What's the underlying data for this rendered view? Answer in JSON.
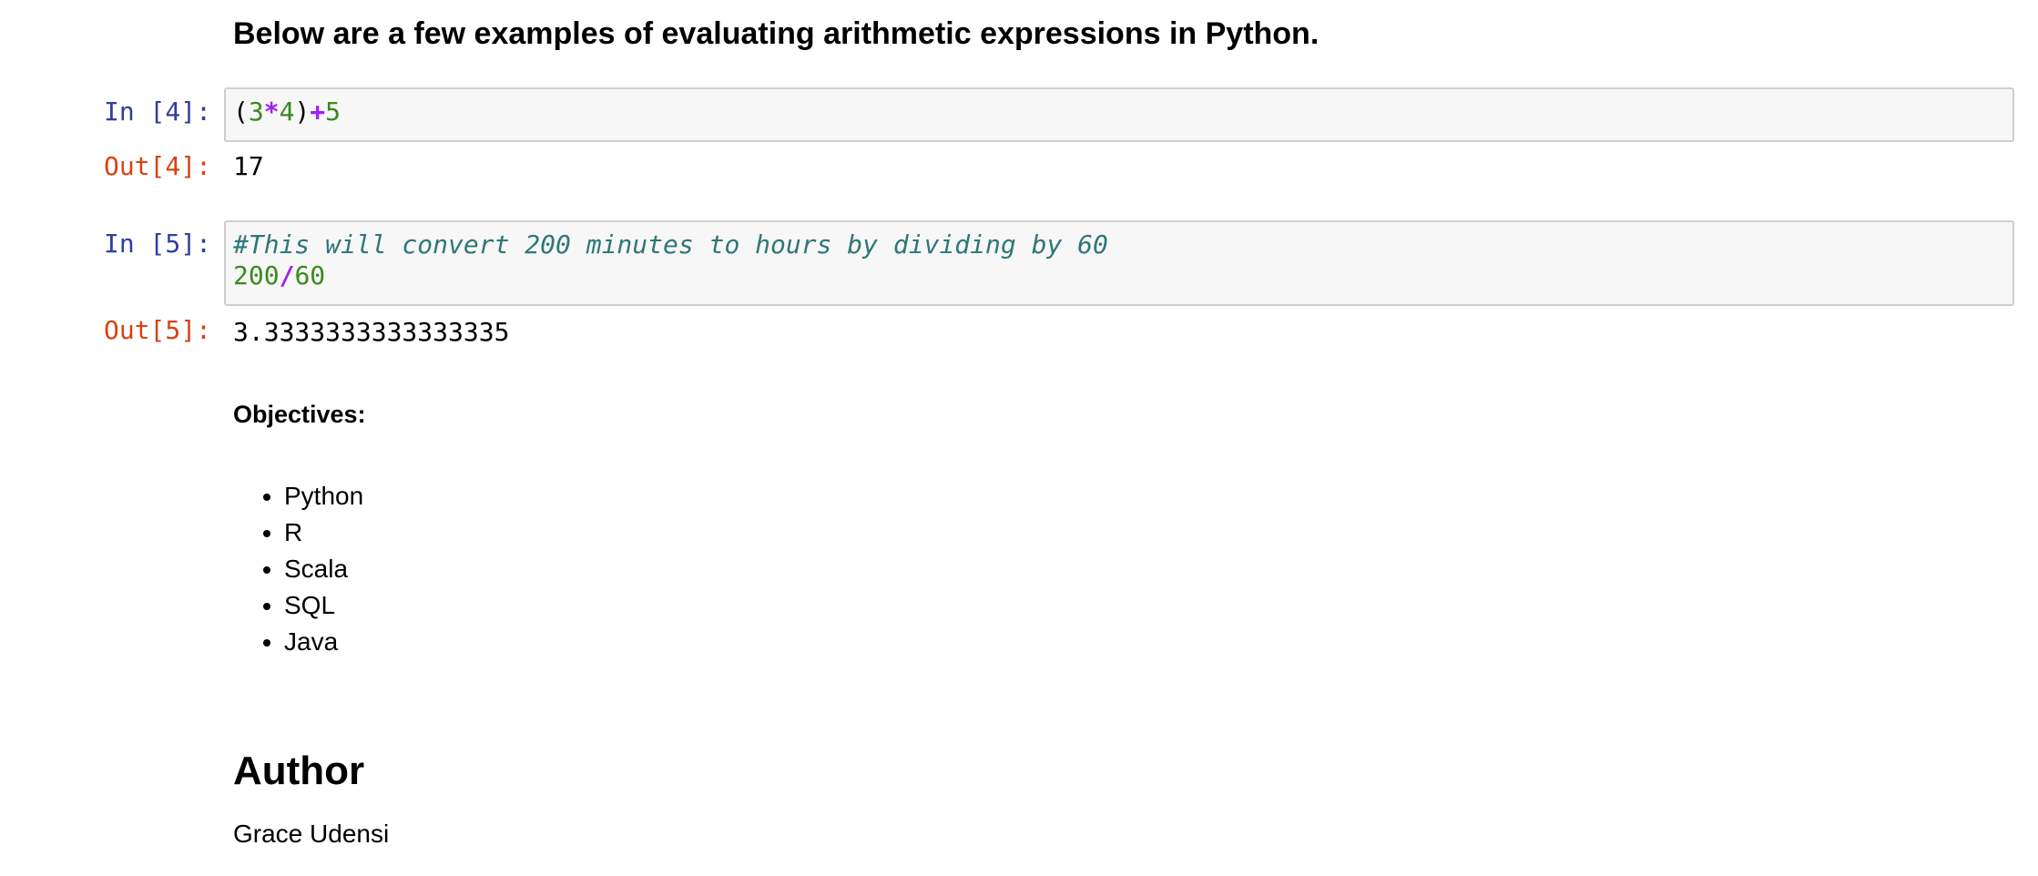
{
  "intro": {
    "heading": "Below are a few examples of evaluating arithmetic expressions in Python."
  },
  "cells": [
    {
      "in_prompt": "In [4]:",
      "code_tokens": [
        "(",
        "3",
        "*",
        "4",
        ")",
        "+",
        "5"
      ],
      "out_prompt": "Out[4]:",
      "output": "17"
    },
    {
      "in_prompt": "In [5]:",
      "comment": "#This will convert 200 minutes to hours by dividing by 60",
      "code_tokens": [
        "200",
        "/",
        "60"
      ],
      "out_prompt": "Out[5]:",
      "output": "3.3333333333333335"
    }
  ],
  "objectives": {
    "title": "Objectives:",
    "items": [
      "Python",
      "R",
      "Scala",
      "SQL",
      "Java"
    ]
  },
  "author": {
    "heading": "Author",
    "name": "Grace Udensi"
  },
  "colors": {
    "in_prompt": "#303f9f",
    "out_prompt": "#d84315",
    "number": "#3a8a1f",
    "operator": "#a020f0",
    "comment": "#2f7777",
    "input_bg": "#f7f7f7",
    "input_border": "#cfcfcf"
  }
}
